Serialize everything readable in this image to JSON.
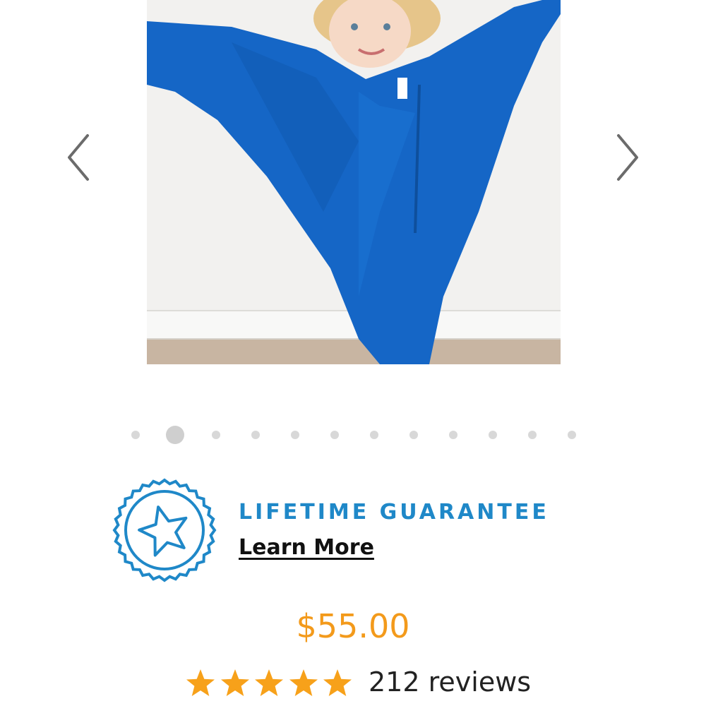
{
  "carousel": {
    "image_alt": "Child wearing blue sensory body sock",
    "prev_icon": "chevron-left-icon",
    "next_icon": "chevron-right-icon",
    "slide_count": 12,
    "active_index": 1
  },
  "guarantee": {
    "icon": "star-seal-badge-icon",
    "title": "LIFETIME GUARANTEE",
    "link_label": "Learn More"
  },
  "product": {
    "price": "$55.00",
    "rating": 5,
    "rating_max": 5,
    "reviews_label": "212 reviews"
  },
  "colors": {
    "accent_blue": "#1f88c8",
    "price_orange": "#f39a1b",
    "star_orange": "#f7a11a",
    "garment_blue": "#1566c6"
  }
}
